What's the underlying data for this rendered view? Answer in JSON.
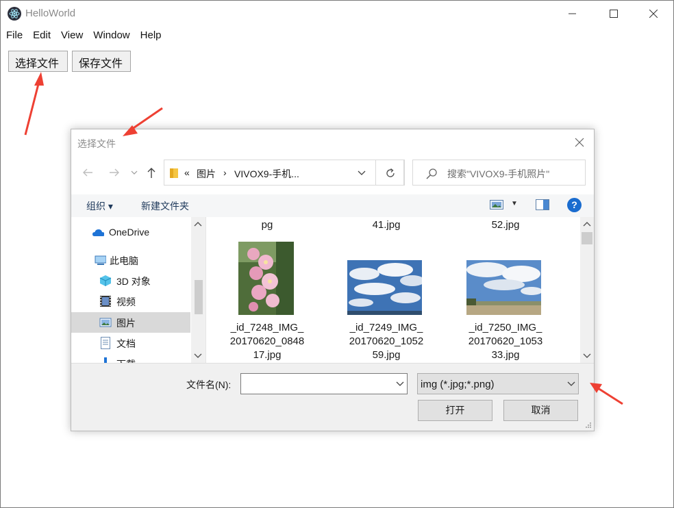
{
  "app": {
    "title": "HelloWorld",
    "menu": [
      "File",
      "Edit",
      "View",
      "Window",
      "Help"
    ],
    "buttons": {
      "select_file": "选择文件",
      "save_file": "保存文件"
    }
  },
  "dialog": {
    "title": "选择文件",
    "address": {
      "overflow": "«",
      "segment1": "图片",
      "separator": "›",
      "segment2": "VIVOX9-手机..."
    },
    "search_placeholder": "搜索\"VIVOX9-手机照片\"",
    "toolbar": {
      "organize": "组织 ▾",
      "new_folder": "新建文件夹",
      "help": "?"
    },
    "nav_items": [
      {
        "label": "OneDrive",
        "icon": "cloud-icon"
      },
      {
        "label": "此电脑",
        "icon": "computer-icon"
      },
      {
        "label": "3D 对象",
        "icon": "cube-icon"
      },
      {
        "label": "视频",
        "icon": "film-icon"
      },
      {
        "label": "图片",
        "icon": "picture-icon",
        "selected": true
      },
      {
        "label": "文档",
        "icon": "document-icon"
      },
      {
        "label": "下载",
        "icon": "download-icon"
      }
    ],
    "files_top_partial": [
      "pg",
      "41.jpg",
      "52.jpg"
    ],
    "files": [
      {
        "name_lines": [
          "_id_7248_IMG_",
          "20170620_0848",
          "17.jpg"
        ],
        "thumb": "pink-hollyhock-photo"
      },
      {
        "name_lines": [
          "_id_7249_IMG_",
          "20170620_1052",
          "59.jpg"
        ],
        "thumb": "cloudy-sky-photo"
      },
      {
        "name_lines": [
          "_id_7250_IMG_",
          "20170620_1053",
          "33.jpg"
        ],
        "thumb": "sky-field-photo"
      }
    ],
    "filename_label": "文件名(N):",
    "filename_value": "",
    "filter": "img (*.jpg;*.png)",
    "open": "打开",
    "cancel": "取消"
  },
  "colors": {
    "annotation_arrow": "#ee4033",
    "help_blue": "#1a6ccf",
    "selected_nav": "#d9d9d9"
  }
}
